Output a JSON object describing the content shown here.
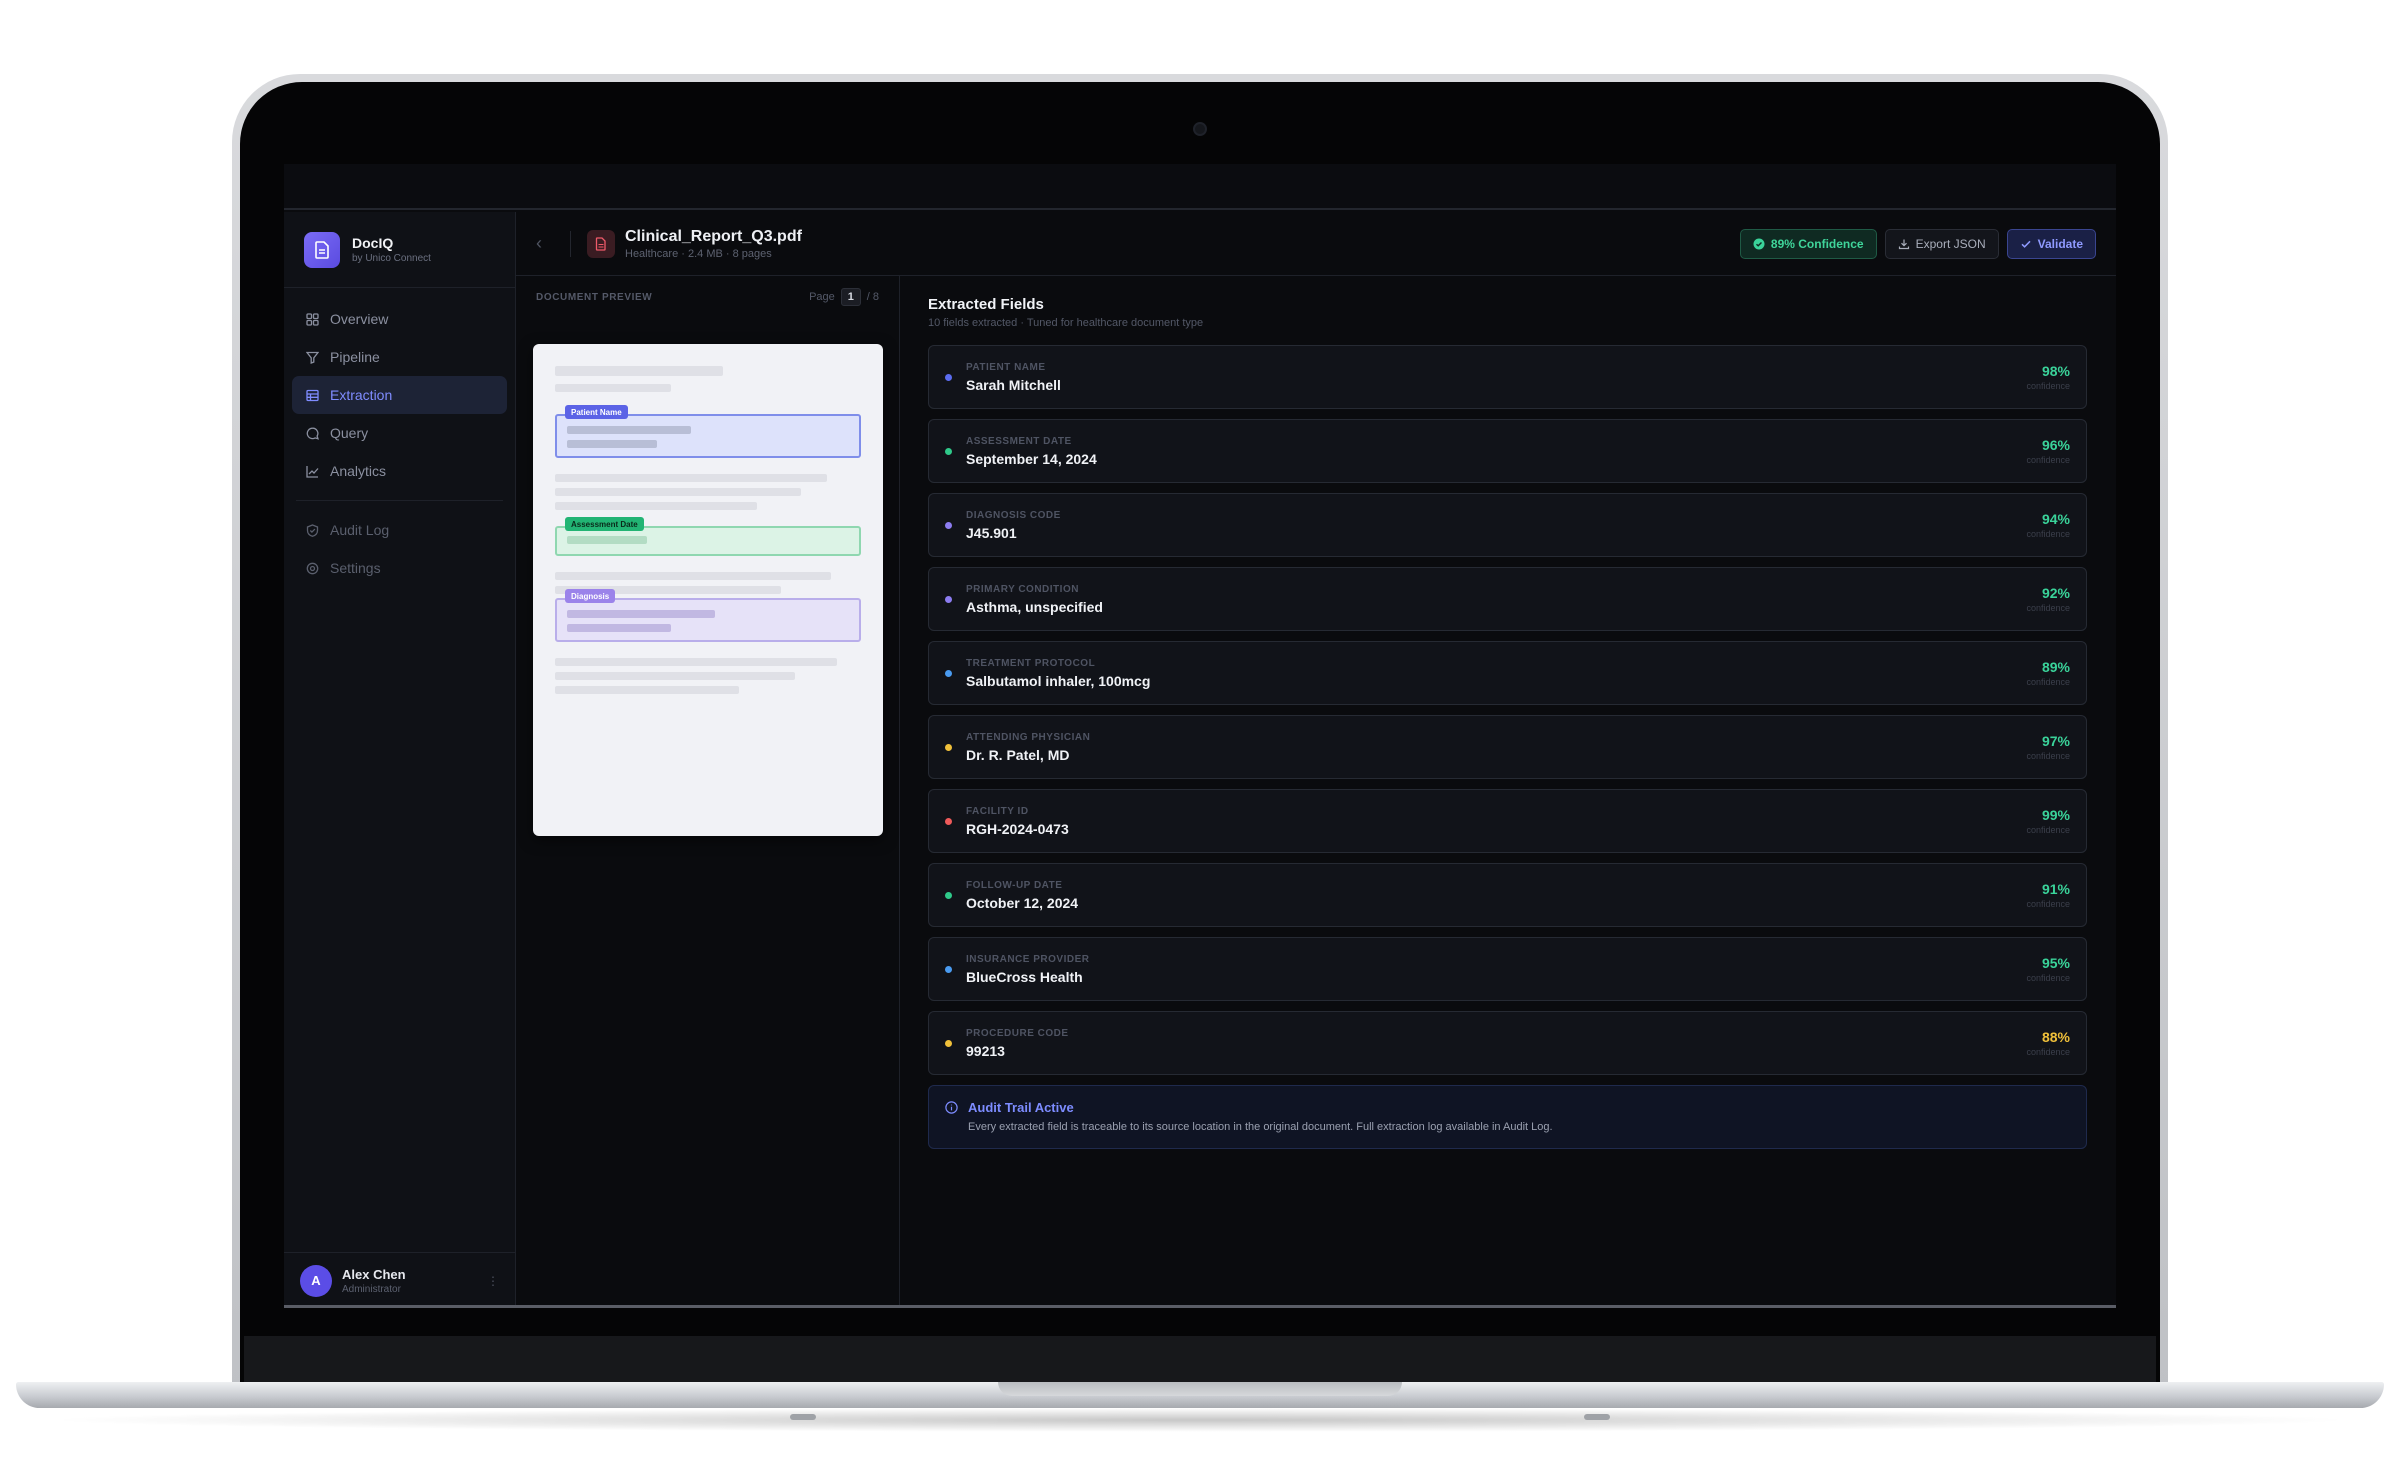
{
  "brand": {
    "name": "DocIQ",
    "subtitle": "by Unico Connect"
  },
  "nav": {
    "items": [
      {
        "label": "Overview",
        "icon": "grid-icon"
      },
      {
        "label": "Pipeline",
        "icon": "filter-icon"
      },
      {
        "label": "Extraction",
        "icon": "table-icon",
        "active": true
      },
      {
        "label": "Query",
        "icon": "chat-icon"
      },
      {
        "label": "Analytics",
        "icon": "chart-icon"
      }
    ],
    "secondary": [
      {
        "label": "Audit Log",
        "icon": "shield-icon"
      },
      {
        "label": "Settings",
        "icon": "gear-icon"
      }
    ]
  },
  "user": {
    "name": "Alex Chen",
    "role": "Administrator",
    "initial": "A"
  },
  "header": {
    "file_name": "Clinical_Report_Q3.pdf",
    "file_meta": "Healthcare · 2.4 MB · 8 pages",
    "confidence_label": "89% Confidence",
    "export_label": "Export JSON",
    "validate_label": "Validate"
  },
  "preview": {
    "label": "DOCUMENT PREVIEW",
    "page_label": "Page",
    "page_current": "1",
    "page_total": "/ 8",
    "tags": {
      "patient": "Patient Name",
      "date": "Assessment Date",
      "diagnosis": "Diagnosis"
    }
  },
  "fields": {
    "title": "Extracted Fields",
    "subtitle": "10 fields extracted · Tuned for healthcare document type",
    "confidence_caption": "confidence",
    "items": [
      {
        "label": "PATIENT NAME",
        "value": "Sarah Mitchell",
        "confidence": "98%",
        "dot": "#5b6cf0"
      },
      {
        "label": "ASSESSMENT DATE",
        "value": "September 14, 2024",
        "confidence": "96%",
        "dot": "#2fc98a"
      },
      {
        "label": "DIAGNOSIS CODE",
        "value": "J45.901",
        "confidence": "94%",
        "dot": "#8c7cf0"
      },
      {
        "label": "PRIMARY CONDITION",
        "value": "Asthma, unspecified",
        "confidence": "92%",
        "dot": "#8c7cf0"
      },
      {
        "label": "TREATMENT PROTOCOL",
        "value": "Salbutamol inhaler, 100mcg",
        "confidence": "89%",
        "dot": "#4a9bf0"
      },
      {
        "label": "ATTENDING PHYSICIAN",
        "value": "Dr. R. Patel, MD",
        "confidence": "97%",
        "dot": "#f0c03a"
      },
      {
        "label": "FACILITY ID",
        "value": "RGH-2024-0473",
        "confidence": "99%",
        "dot": "#ef5a5a"
      },
      {
        "label": "FOLLOW-UP DATE",
        "value": "October 12, 2024",
        "confidence": "91%",
        "dot": "#2fc98a"
      },
      {
        "label": "INSURANCE PROVIDER",
        "value": "BlueCross Health",
        "confidence": "95%",
        "dot": "#4a9bf0"
      },
      {
        "label": "PROCEDURE CODE",
        "value": "99213",
        "confidence": "88%",
        "dot": "#f0c03a",
        "warn": true
      }
    ]
  },
  "audit": {
    "title": "Audit Trail Active",
    "text": "Every extracted field is traceable to its source location in the original document. Full extraction log available in Audit Log."
  },
  "colors": {
    "accent": "#7f8cff",
    "success": "#3ad39a",
    "warning": "#f0c03a",
    "background": "#0a0b0e"
  }
}
